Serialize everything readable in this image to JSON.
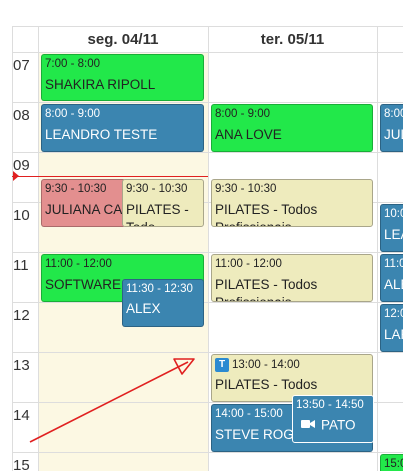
{
  "columns": [
    {
      "label": "seg. 04/11"
    },
    {
      "label": "ter. 05/11"
    }
  ],
  "hours": [
    "07",
    "08",
    "09",
    "10",
    "11",
    "12",
    "13",
    "14",
    "15"
  ],
  "events": {
    "e1": {
      "time": "7:00 - 8:00",
      "name": "SHAKIRA RIPOLL"
    },
    "e2": {
      "time": "8:00 - 9:00",
      "name": "LEANDRO TESTE"
    },
    "e3": {
      "time": "9:30 - 10:30",
      "name": "JULIANA CAE"
    },
    "e4": {
      "time": "9:30 - 10:30",
      "name": "PILATES -",
      "extra": "Todo"
    },
    "e5": {
      "time": "11:00 - 12:00",
      "name": "SOFTWARE P"
    },
    "e6": {
      "time": "11:30 - 12:30",
      "name": "ALEX"
    },
    "e7": {
      "time": "8:00 - 9:00",
      "name": "ANA LOVE"
    },
    "e8": {
      "time": "9:30 - 10:30",
      "name": "PILATES - Todos",
      "extra": "Profissionais"
    },
    "e9": {
      "time": "11:00 - 12:00",
      "name": "PILATES - Todos",
      "extra": "Profissionais"
    },
    "e10": {
      "time": "13:00 - 14:00",
      "name": "PILATES - Todos",
      "badge": "T"
    },
    "e11": {
      "time": "14:00 - 15:00",
      "name": "STEVE ROGERS"
    },
    "e12": {
      "time": "13:50 - 14:50",
      "name": "PATO"
    },
    "p1": {
      "time": "8:00",
      "name": "JUL"
    },
    "p2": {
      "time": "10:0",
      "name": "LEA"
    },
    "p3": {
      "time": "11:0",
      "name": "ALE"
    },
    "p4": {
      "time": "12:0",
      "name": "LAR"
    },
    "p5": {
      "time": "15:0"
    }
  },
  "colors": {
    "green": "#22e84a",
    "blue": "#3b85b0",
    "beige": "#eeebbd",
    "pink": "#e38f8f",
    "today_bg": "#fcf8e3",
    "now_line": "#e02020",
    "annotation": "#e02020"
  }
}
